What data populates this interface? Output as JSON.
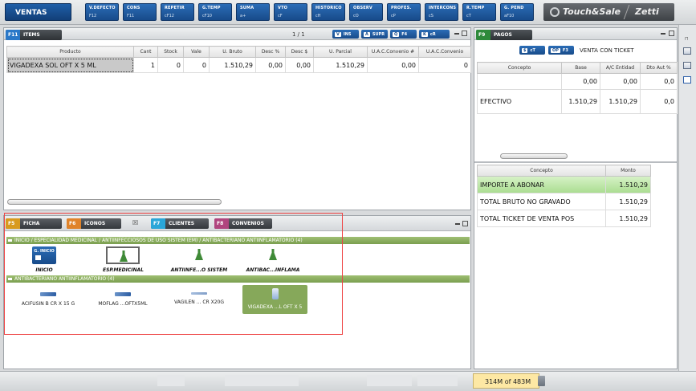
{
  "toolbar": {
    "ventas_label": "VENTAS",
    "buttons": [
      {
        "label": "V.DEFECTO",
        "key": "F12"
      },
      {
        "label": "CONS",
        "key": "F11"
      },
      {
        "label": "REPETIR",
        "key": "cF12"
      },
      {
        "label": "G.TEMP",
        "key": "cF10"
      },
      {
        "label": "SUMA",
        "key": "a+"
      },
      {
        "label": "VTO",
        "key": "cF"
      },
      {
        "label": "HISTORICO",
        "key": "cH"
      },
      {
        "label": "OBSERV",
        "key": "cO"
      },
      {
        "label": "PROFES.",
        "key": "cP"
      },
      {
        "label": "INTERCONS",
        "key": "cS"
      },
      {
        "label": "R.TEMP",
        "key": "cT"
      },
      {
        "label": "G. PEND",
        "key": "aF10"
      }
    ],
    "brand_left": "Touch&Sale",
    "brand_right": "Zetti"
  },
  "items_panel": {
    "tab_key": "F11",
    "tab_label": "ITEMS",
    "page_indicator": "1 / 1",
    "mini_buttons": [
      {
        "icon": "V",
        "label": "INS"
      },
      {
        "icon": "A",
        "label": "SUPR"
      },
      {
        "icon": "Q",
        "label": "F4"
      },
      {
        "icon": "K",
        "label": "cR"
      }
    ],
    "columns": [
      "Producto",
      "Cant",
      "Stock",
      "Vale",
      "U. Bruto",
      "Desc %",
      "Desc $",
      "U. Parcial",
      "U.A.C.Convenio #",
      "U.A.C.Convenio"
    ],
    "rows": [
      [
        "VIGADEXA SOL OFT X 5 ML",
        "1",
        "0",
        "0",
        "1.510,29",
        "0,00",
        "0,00",
        "1.510,29",
        "0,00",
        "0"
      ]
    ]
  },
  "bottom_panel": {
    "tabs": [
      {
        "key": "F5",
        "label": "FICHA",
        "color": "#d89a1d"
      },
      {
        "key": "F6",
        "label": "ICONOS",
        "color": "#e0832a"
      },
      {
        "key": "F7",
        "label": "CLIENTES",
        "color": "#2aa6d8"
      },
      {
        "key": "F8",
        "label": "CONVENIOS",
        "color": "#b0457e"
      }
    ],
    "group1_path": "INICIO / ESPECIALIDAD MEDICINAL          / ANTIINFECCIOSOS DE USO SISTEM    (EM) / ANTIBACTERIANO ANTIINFLAMATORIO (4)",
    "inicio_tile_text": "G. INICIO",
    "tiles": [
      "INICIO",
      "ESP.MEDICINAL",
      "ANTIINFE...O SISTEM",
      "ANTIBAC...INFLAMA"
    ],
    "group2_path": "ANTIBACTERIANO ANTIINFLAMATORIO (4)",
    "products": [
      "ACIFUSIN B CR X 15 G",
      "MOFLAG ...OFTX5ML",
      "VAGILEN ... CR X20G",
      "VIGADEXA ...L OFT X 5"
    ]
  },
  "pagos_panel": {
    "tab_key": "F9",
    "tab_label": "PAGOS",
    "ct_label": "cT",
    "op_label": "OP",
    "f3_label": "F3",
    "venta_label": "VENTA CON TICKET",
    "columns": [
      "Concepto",
      "Base",
      "A/C Entidad",
      "Dto Aut %"
    ],
    "rows": [
      [
        "",
        "0,00",
        "0,00",
        "0,0"
      ],
      [
        "EFECTIVO",
        "1.510,29",
        "1.510,29",
        "0,0"
      ]
    ],
    "summary_columns": [
      "Concepto",
      "Monto"
    ],
    "summary_rows": [
      [
        "IMPORTE A ABONAR",
        "1.510,29"
      ],
      [
        "TOTAL BRUTO NO GRAVADO",
        "1.510,29"
      ],
      [
        "TOTAL TICKET DE VENTA POS",
        "1.510,29"
      ]
    ]
  },
  "status": {
    "memory": "314M of 483M"
  },
  "colors": {
    "accent_blue": "#1c5699",
    "group_green": "#86a85a",
    "highlight_row": "#c8ebb5",
    "memory_bg": "#fde8a4"
  }
}
